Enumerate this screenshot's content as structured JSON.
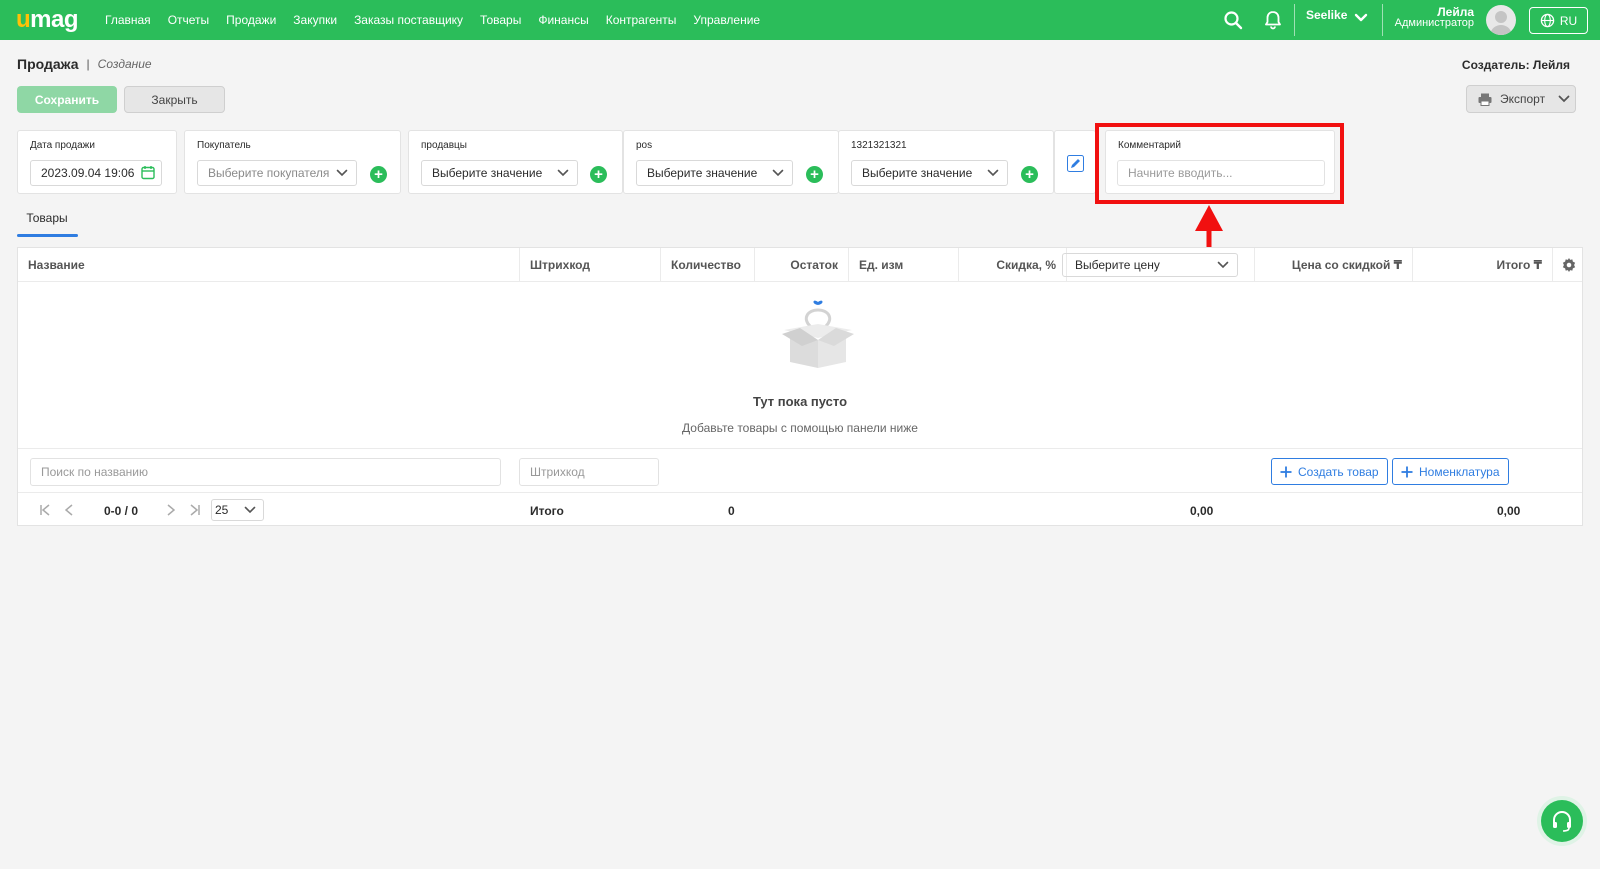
{
  "brand": {
    "logo_u": "u",
    "logo_rest": "mag",
    "accent": "#2bbd5a",
    "logo_accent": "#ffc107",
    "link_blue": "#2f7de1",
    "highlight_red": "#f11010"
  },
  "nav": [
    "Главная",
    "Отчеты",
    "Продажи",
    "Закупки",
    "Заказы поставщику",
    "Товары",
    "Финансы",
    "Контрагенты",
    "Управление"
  ],
  "topbar": {
    "org": "Seelike",
    "user_name": "Лейла",
    "user_role": "Администратор",
    "lang": "RU",
    "icons": [
      "search-icon",
      "bell-icon",
      "chevron-down-icon",
      "avatar",
      "globe-icon"
    ]
  },
  "header": {
    "title": "Продажа",
    "separator": "|",
    "subtitle": "Создание",
    "creator": "Создатель: Лейля"
  },
  "actions": {
    "save": "Сохранить",
    "close": "Закрыть",
    "export": "Экспорт"
  },
  "fields": {
    "date": {
      "label": "Дата продажи",
      "value": "2023.09.04 19:06"
    },
    "buyer": {
      "label": "Покупатель",
      "placeholder": "Выберите покупателя"
    },
    "sellers": {
      "label": "продавцы",
      "value": "Выберите значение"
    },
    "pos": {
      "label": "pos",
      "value": "Выберите значение"
    },
    "custom": {
      "label": "1321321321",
      "value": "Выберите значение"
    },
    "comment": {
      "label": "Комментарий",
      "placeholder": "Начните вводить..."
    }
  },
  "tabs": {
    "goods": "Товары"
  },
  "table": {
    "columns": {
      "name": "Название",
      "barcode": "Штрихкод",
      "qty": "Количество",
      "stock": "Остаток",
      "unit": "Ед. изм",
      "discount": "Скидка, %",
      "price_select": "Выберите цену",
      "discounted_price": "Цена со скидкой ₸",
      "total": "Итого ₸"
    },
    "empty_title": "Тут пока пусто",
    "empty_subtitle": "Добавьте товары с помощью панели ниже",
    "search_placeholder": "Поиск по названию",
    "barcode_placeholder": "Штрихкод",
    "create_product": "Создать товар",
    "nomenclature": "Номенклатура"
  },
  "footer": {
    "range": "0-0 / 0",
    "page_size": "25",
    "total_label": "Итого",
    "total_qty": "0",
    "total_discounted": "0,00",
    "total_sum": "0,00"
  }
}
